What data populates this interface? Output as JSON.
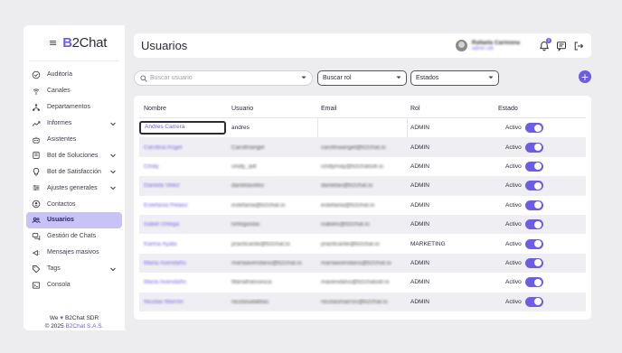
{
  "brand": {
    "logo_b": "B",
    "logo_rest": "2Chat"
  },
  "sidebar": {
    "items": [
      {
        "label": "Auditoría",
        "icon": "check-circle-icon",
        "chevron": false
      },
      {
        "label": "Canales",
        "icon": "antenna-icon",
        "chevron": false
      },
      {
        "label": "Departamentos",
        "icon": "org-chart-icon",
        "chevron": false
      },
      {
        "label": "Informes",
        "icon": "trend-icon",
        "chevron": true
      },
      {
        "label": "Asistentes",
        "icon": "robot-icon",
        "chevron": false
      },
      {
        "label": "Bot de Soluciones",
        "icon": "book-icon",
        "chevron": true
      },
      {
        "label": "Bot de Satisfacción",
        "icon": "lightbulb-icon",
        "chevron": true
      },
      {
        "label": "Ajustes generales",
        "icon": "sliders-icon",
        "chevron": true
      },
      {
        "label": "Contactos",
        "icon": "contact-icon",
        "chevron": false
      },
      {
        "label": "Usuarios",
        "icon": "users-icon",
        "chevron": false,
        "active": true
      },
      {
        "label": "Gestión de Chats",
        "icon": "chats-icon",
        "chevron": false
      },
      {
        "label": "Mensajes masivos",
        "icon": "broadcast-icon",
        "chevron": false
      },
      {
        "label": "Tags",
        "icon": "tag-icon",
        "chevron": true
      },
      {
        "label": "Consola",
        "icon": "console-icon",
        "chevron": false
      }
    ],
    "footer_line1_pre": "We",
    "footer_line1_post": "B2Chat SDR",
    "footer_line2_pre": "© 2025",
    "footer_line2_company": "B2Chat S.A.S."
  },
  "header": {
    "title": "Usuarios",
    "user_name": "Rafaela Carmona",
    "user_role": "admin sdr",
    "notifications_count": "1"
  },
  "filters": {
    "search_placeholder": "Buscar usuario",
    "rol_placeholder": "Buscar rol",
    "estados_placeholder": "Estados",
    "add_label": "+"
  },
  "table": {
    "columns": [
      "Nombre",
      "Usuario",
      "Email",
      "Rol",
      "Estado"
    ],
    "rows": [
      {
        "nombre": "Andres Carrera",
        "usuario": "andres",
        "email": "",
        "rol": "ADMIN",
        "estado": "Activo"
      },
      {
        "nombre": "Carolina Angel",
        "usuario": "Carolinangel",
        "email": "carolinaangel@b2chat.io",
        "rol": "ADMIN",
        "estado": "Activo"
      },
      {
        "nombre": "Cindy",
        "usuario": "cindy_adl",
        "email": "cindymay@b2chatsdr.io",
        "rol": "ADMIN",
        "estado": "Activo"
      },
      {
        "nombre": "Daniela Velez",
        "usuario": "danielavelez",
        "email": "danielav@b2chat.io",
        "rol": "ADMIN",
        "estado": "Activo"
      },
      {
        "nombre": "Estefania Pelaez",
        "usuario": "estefania@b2chat.io",
        "email": "estefania@b2chat.io",
        "rol": "ADMIN",
        "estado": "Activo"
      },
      {
        "nombre": "Isabel Ortega",
        "usuario": "iortegaslas",
        "email": "isabelo@b2chat.io",
        "rol": "ADMIN",
        "estado": "Activo"
      },
      {
        "nombre": "Karina Ayala",
        "usuario": "practicante@b2chat.io",
        "email": "practicante@b2chat.io",
        "rol": "MARKETING",
        "estado": "Activo"
      },
      {
        "nombre": "Maria Avendaño",
        "usuario": "mariaavendano@b2chat.io",
        "email": "mariaavendano@b2chat.io",
        "rol": "ADMIN",
        "estado": "Activo"
      },
      {
        "nombre": "Maria Avendaño",
        "usuario": "Mariafrancesca",
        "email": "mavendano@b2chatsdr.io",
        "rol": "ADMIN",
        "estado": "Activo"
      },
      {
        "nombre": "Nicolas Marrón",
        "usuario": "nicolasalabtas",
        "email": "nicolasmarron@b2chat.io",
        "rol": "ADMIN",
        "estado": "Activo"
      }
    ]
  },
  "colors": {
    "accent": "#6c5ce7",
    "active_nav_bg": "#c8c3f7",
    "page_bg": "#ededf0"
  }
}
